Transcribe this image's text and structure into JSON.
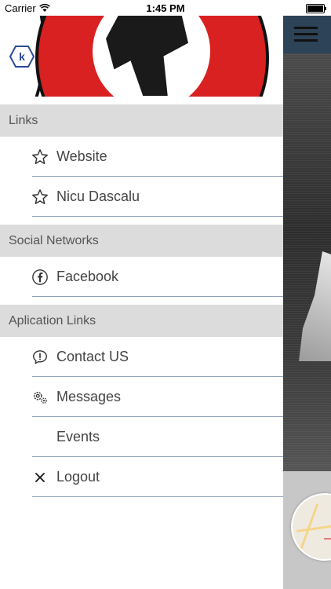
{
  "status_bar": {
    "carrier": "Carrier",
    "time": "1:45 PM"
  },
  "logo": {
    "badge_letter": "k"
  },
  "menu": {
    "sections": [
      {
        "header": "Links",
        "items": [
          {
            "label": "Website",
            "icon": "star-icon"
          },
          {
            "label": "Nicu Dascalu",
            "icon": "star-icon"
          }
        ]
      },
      {
        "header": "Social Networks",
        "items": [
          {
            "label": "Facebook",
            "icon": "facebook-icon"
          }
        ]
      },
      {
        "header": "Aplication Links",
        "items": [
          {
            "label": "Contact US",
            "icon": "speech-bubble-exclamation-icon"
          },
          {
            "label": "Messages",
            "icon": "gears-icon"
          },
          {
            "label": "Events",
            "icon": ""
          },
          {
            "label": "Logout",
            "icon": "close-icon"
          }
        ]
      }
    ]
  },
  "colors": {
    "section_header_bg": "#dcdcdc",
    "separator": "#8fa3b8",
    "navbar": "#2d4357",
    "logo_red": "#d92121"
  }
}
